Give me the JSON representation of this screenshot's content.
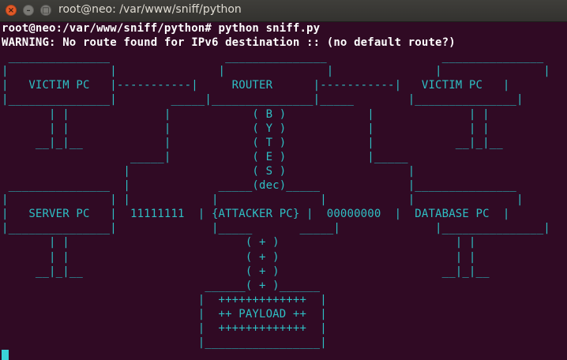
{
  "window": {
    "title": "root@neo: /var/www/sniff/python",
    "close_glyph": "×",
    "min_glyph": "–",
    "max_glyph": "□"
  },
  "terminal": {
    "prompt_line": "root@neo:/var/www/sniff/python# python sniff.py",
    "warning_line": "WARNING: No route found for IPv6 destination :: (no default route?)",
    "ascii_art": [
      " _______________                 _______________                 _______________",
      "|               |               |               |               |               |",
      "|   VICTIM PC   |-----------|     ROUTER      |-----------|   VICTIM PC   |",
      "|_______________|        _____|_______________|_____        |_______________|",
      "       | |              |            ( B )            |              | |",
      "       | |              |            ( Y )            |              | |",
      "     __|_|__            |            ( T )            |            __|_|__",
      "                   _____|            ( E )            |_____",
      "                  |                  ( S )                  |",
      " _______________  |             _____(dec)_____             |_______________",
      "|               | |            |               |            |               |",
      "|   SERVER PC   |  11111111  | {ATTACKER PC} |  00000000  |  DATABASE PC  |",
      "|_______________|              |_____       _____|              |_______________|",
      "       | |                          ( + )                          | |",
      "       | |                          ( + )                          | |",
      "     __|_|__                        ( + )                        __|_|__",
      "                              ______( + )______",
      "                             |  +++++++++++++  |",
      "                             |  ++ PAYLOAD ++  |",
      "                             |  +++++++++++++  |",
      "                             |_________________|"
    ]
  }
}
